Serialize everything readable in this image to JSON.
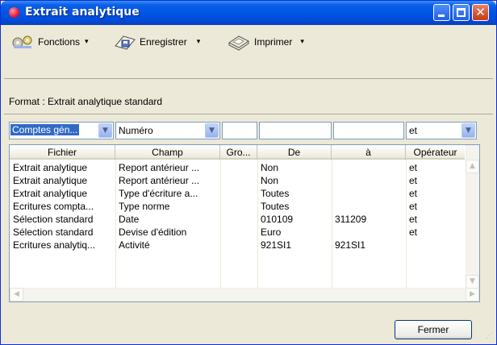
{
  "window": {
    "title": "Extrait analytique",
    "controls": {
      "minimize": "minimize-icon",
      "maximize": "maximize-icon",
      "close": "close-icon"
    }
  },
  "toolbar": {
    "functions_label": "Fonctions",
    "save_label": "Enregistrer",
    "print_label": "Imprimer",
    "dropdown_glyph": "▾"
  },
  "format": {
    "label": "Format : Extrait analytique standard"
  },
  "filters": {
    "account_combo": "Comptes gén...",
    "field_combo": "Numéro",
    "operator_combo": "et"
  },
  "table": {
    "columns": [
      "Fichier",
      "Champ",
      "Gro...",
      "De",
      "à",
      "Opérateur"
    ],
    "rows": [
      [
        "Extrait analytique",
        "Report antérieur ...",
        "",
        "Non",
        "",
        "et"
      ],
      [
        "Extrait analytique",
        "Report antérieur ...",
        "",
        "Non",
        "",
        "et"
      ],
      [
        "Extrait analytique",
        "Type d'écriture a...",
        "",
        "Toutes",
        "",
        "et"
      ],
      [
        "Ecritures compta...",
        "Type norme",
        "",
        "Toutes",
        "",
        "et"
      ],
      [
        "Sélection standard",
        "Date",
        "",
        "010109",
        "311209",
        "et"
      ],
      [
        "Sélection standard",
        "Devise d'édition",
        "",
        "Euro",
        "",
        "et"
      ],
      [
        "Ecritures analytiq...",
        "Activité",
        "",
        "921SI1",
        "921SI1",
        ""
      ]
    ]
  },
  "footer": {
    "close_label": "Fermer"
  },
  "colors": {
    "title_bar": "#0054e3",
    "selection": "#316ac5",
    "window_bg": "#ece9d8"
  }
}
